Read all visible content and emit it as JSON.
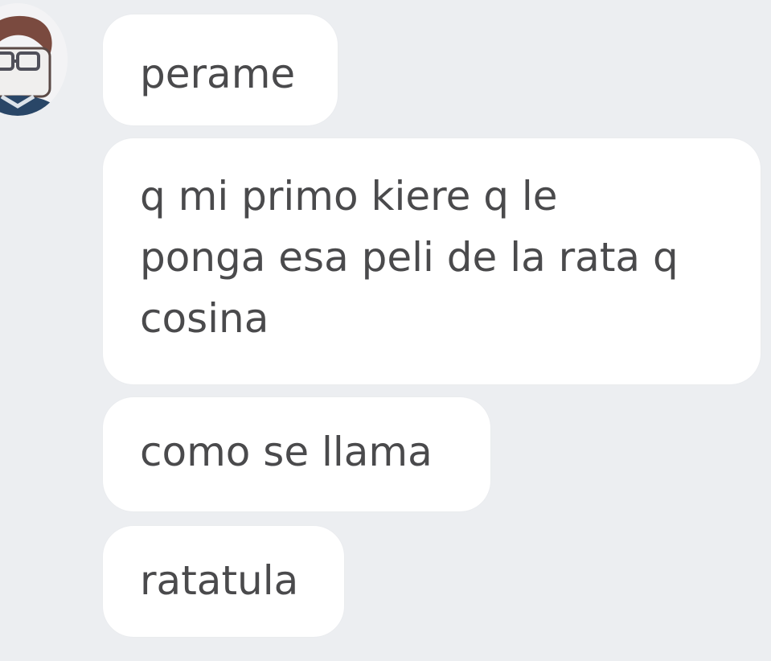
{
  "conversation": {
    "avatar_icon": "user-avatar-icon",
    "colors": {
      "background": "#eceef1",
      "bubble": "#ffffff",
      "text": "#4a4a4c"
    },
    "messages": [
      {
        "text": "perame"
      },
      {
        "text": "q mi primo kiere q le\nponga esa peli de la rata q\ncosina"
      },
      {
        "text": "como se llama"
      },
      {
        "text": "ratatula"
      }
    ]
  }
}
